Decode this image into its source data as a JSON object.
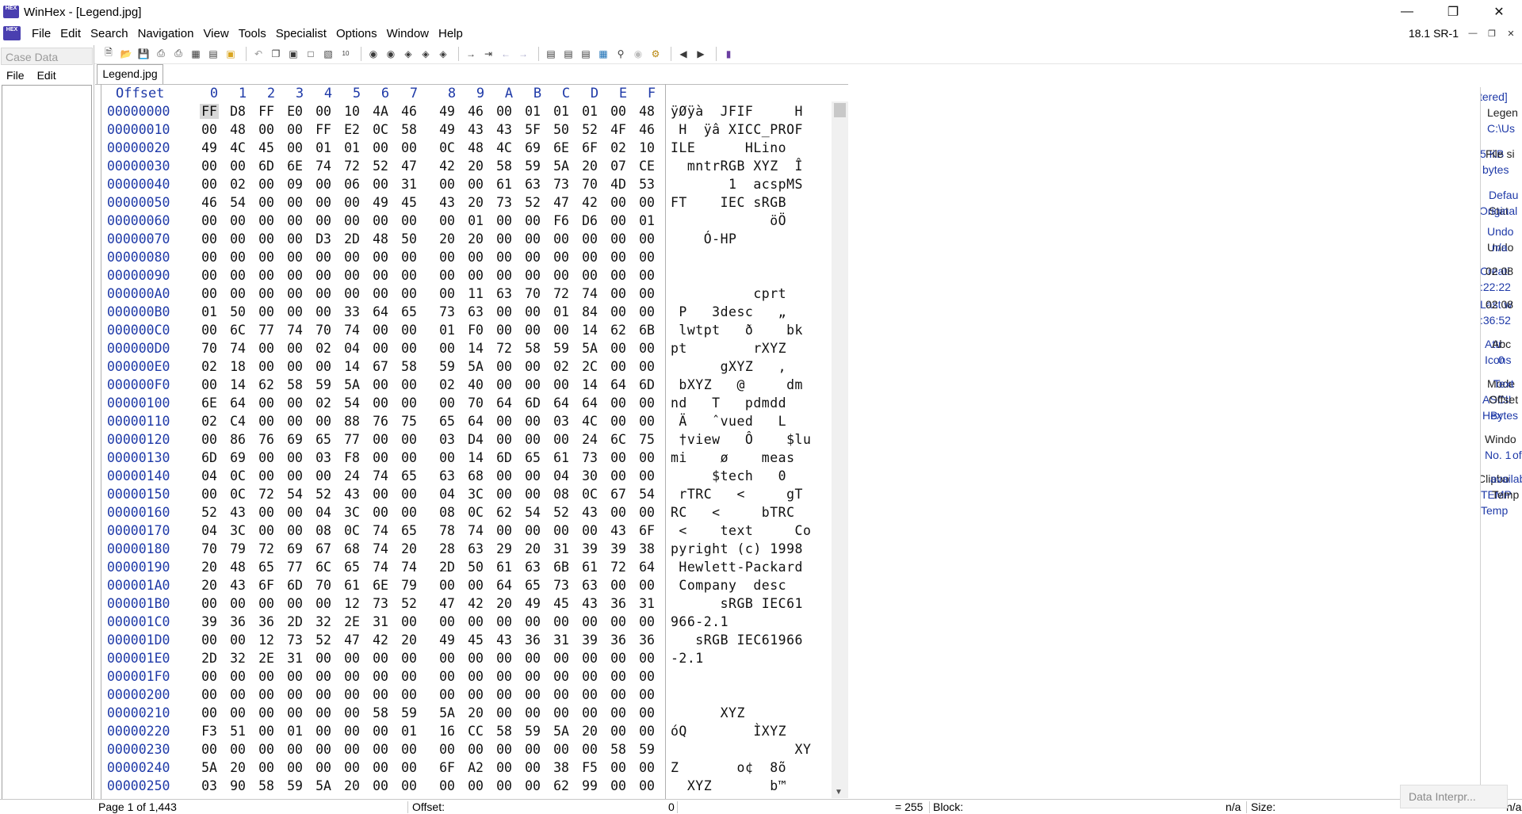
{
  "window": {
    "title": "WinHex - [Legend.jpg]",
    "app_icon": "winhex-app-icon",
    "buttons": [
      "minimize-icon",
      "restore-icon",
      "close-icon"
    ]
  },
  "menubar": {
    "items": [
      "File",
      "Edit",
      "Search",
      "Navigation",
      "View",
      "Tools",
      "Specialist",
      "Options",
      "Window",
      "Help"
    ],
    "version": "18.1 SR-1",
    "mdi_buttons": [
      "minimize-icon",
      "restore-icon",
      "close-icon"
    ]
  },
  "toolbar": {
    "icons": [
      "new-file-icon",
      "open-file-icon",
      "save-icon",
      "save-all-icon",
      "print-icon",
      "properties-icon",
      "open-disk-icon",
      "save-as-icon",
      "undo-icon",
      "copy-icon",
      "cut-icon",
      "paste-icon",
      "paste-clipboard-icon",
      "write-hex-icon",
      "find-text-icon",
      "find-hex-icon",
      "replace-text-icon",
      "replace-hex-icon",
      "find-again-icon",
      "goto-offset-icon",
      "goto-sector-icon",
      "back-icon",
      "forward-icon",
      "open-drive-icon",
      "disk-editor-icon",
      "ram-editor-icon",
      "calculator-icon",
      "search-icon",
      "position-manager-icon",
      "analyze-icon",
      "prev-page-icon",
      "next-page-icon",
      "help-book-icon"
    ]
  },
  "case_panel": {
    "title": "Case Data",
    "menu": [
      "File",
      "Edit"
    ]
  },
  "tab": {
    "label": "Legend.jpg"
  },
  "hex": {
    "offset_header": "Offset",
    "columns": [
      "0",
      "1",
      "2",
      "3",
      "4",
      "5",
      "6",
      "7",
      "8",
      "9",
      "A",
      "B",
      "C",
      "D",
      "E",
      "F"
    ],
    "rows": [
      {
        "offset": "00000000",
        "bytes": [
          "FF",
          "D8",
          "FF",
          "E0",
          "00",
          "10",
          "4A",
          "46",
          "49",
          "46",
          "00",
          "01",
          "01",
          "01",
          "00",
          "48"
        ],
        "ascii": "ÿØÿà  JFIF     H"
      },
      {
        "offset": "00000010",
        "bytes": [
          "00",
          "48",
          "00",
          "00",
          "FF",
          "E2",
          "0C",
          "58",
          "49",
          "43",
          "43",
          "5F",
          "50",
          "52",
          "4F",
          "46"
        ],
        "ascii": " H  ÿâ XICC_PROF"
      },
      {
        "offset": "00000020",
        "bytes": [
          "49",
          "4C",
          "45",
          "00",
          "01",
          "01",
          "00",
          "00",
          "0C",
          "48",
          "4C",
          "69",
          "6E",
          "6F",
          "02",
          "10"
        ],
        "ascii": "ILE      HLino  "
      },
      {
        "offset": "00000030",
        "bytes": [
          "00",
          "00",
          "6D",
          "6E",
          "74",
          "72",
          "52",
          "47",
          "42",
          "20",
          "58",
          "59",
          "5A",
          "20",
          "07",
          "CE"
        ],
        "ascii": "  mntrRGB XYZ  Î"
      },
      {
        "offset": "00000040",
        "bytes": [
          "00",
          "02",
          "00",
          "09",
          "00",
          "06",
          "00",
          "31",
          "00",
          "00",
          "61",
          "63",
          "73",
          "70",
          "4D",
          "53"
        ],
        "ascii": "       1  acspMS"
      },
      {
        "offset": "00000050",
        "bytes": [
          "46",
          "54",
          "00",
          "00",
          "00",
          "00",
          "49",
          "45",
          "43",
          "20",
          "73",
          "52",
          "47",
          "42",
          "00",
          "00"
        ],
        "ascii": "FT    IEC sRGB  "
      },
      {
        "offset": "00000060",
        "bytes": [
          "00",
          "00",
          "00",
          "00",
          "00",
          "00",
          "00",
          "00",
          "00",
          "01",
          "00",
          "00",
          "F6",
          "D6",
          "00",
          "01"
        ],
        "ascii": "            öÖ  "
      },
      {
        "offset": "00000070",
        "bytes": [
          "00",
          "00",
          "00",
          "00",
          "D3",
          "2D",
          "48",
          "50",
          "20",
          "20",
          "00",
          "00",
          "00",
          "00",
          "00",
          "00"
        ],
        "ascii": "    Ó-HP        "
      },
      {
        "offset": "00000080",
        "bytes": [
          "00",
          "00",
          "00",
          "00",
          "00",
          "00",
          "00",
          "00",
          "00",
          "00",
          "00",
          "00",
          "00",
          "00",
          "00",
          "00"
        ],
        "ascii": ""
      },
      {
        "offset": "00000090",
        "bytes": [
          "00",
          "00",
          "00",
          "00",
          "00",
          "00",
          "00",
          "00",
          "00",
          "00",
          "00",
          "00",
          "00",
          "00",
          "00",
          "00"
        ],
        "ascii": ""
      },
      {
        "offset": "000000A0",
        "bytes": [
          "00",
          "00",
          "00",
          "00",
          "00",
          "00",
          "00",
          "00",
          "00",
          "11",
          "63",
          "70",
          "72",
          "74",
          "00",
          "00"
        ],
        "ascii": "          cprt  "
      },
      {
        "offset": "000000B0",
        "bytes": [
          "01",
          "50",
          "00",
          "00",
          "00",
          "33",
          "64",
          "65",
          "73",
          "63",
          "00",
          "00",
          "01",
          "84",
          "00",
          "00"
        ],
        "ascii": " P   3desc   „  "
      },
      {
        "offset": "000000C0",
        "bytes": [
          "00",
          "6C",
          "77",
          "74",
          "70",
          "74",
          "00",
          "00",
          "01",
          "F0",
          "00",
          "00",
          "00",
          "14",
          "62",
          "6B"
        ],
        "ascii": " lwtpt   ð    bk"
      },
      {
        "offset": "000000D0",
        "bytes": [
          "70",
          "74",
          "00",
          "00",
          "02",
          "04",
          "00",
          "00",
          "00",
          "14",
          "72",
          "58",
          "59",
          "5A",
          "00",
          "00"
        ],
        "ascii": "pt        rXYZ  "
      },
      {
        "offset": "000000E0",
        "bytes": [
          "02",
          "18",
          "00",
          "00",
          "00",
          "14",
          "67",
          "58",
          "59",
          "5A",
          "00",
          "00",
          "02",
          "2C",
          "00",
          "00"
        ],
        "ascii": "      gXYZ   ,  "
      },
      {
        "offset": "000000F0",
        "bytes": [
          "00",
          "14",
          "62",
          "58",
          "59",
          "5A",
          "00",
          "00",
          "02",
          "40",
          "00",
          "00",
          "00",
          "14",
          "64",
          "6D"
        ],
        "ascii": " bXYZ   @     dm"
      },
      {
        "offset": "00000100",
        "bytes": [
          "6E",
          "64",
          "00",
          "00",
          "02",
          "54",
          "00",
          "00",
          "00",
          "70",
          "64",
          "6D",
          "64",
          "64",
          "00",
          "00"
        ],
        "ascii": "nd   T   pdmdd  "
      },
      {
        "offset": "00000110",
        "bytes": [
          "02",
          "C4",
          "00",
          "00",
          "00",
          "88",
          "76",
          "75",
          "65",
          "64",
          "00",
          "00",
          "03",
          "4C",
          "00",
          "00"
        ],
        "ascii": " Ä   ˆvued   L  "
      },
      {
        "offset": "00000120",
        "bytes": [
          "00",
          "86",
          "76",
          "69",
          "65",
          "77",
          "00",
          "00",
          "03",
          "D4",
          "00",
          "00",
          "00",
          "24",
          "6C",
          "75"
        ],
        "ascii": " †view   Ô    $lu"
      },
      {
        "offset": "00000130",
        "bytes": [
          "6D",
          "69",
          "00",
          "00",
          "03",
          "F8",
          "00",
          "00",
          "00",
          "14",
          "6D",
          "65",
          "61",
          "73",
          "00",
          "00"
        ],
        "ascii": "mi    ø    meas  "
      },
      {
        "offset": "00000140",
        "bytes": [
          "04",
          "0C",
          "00",
          "00",
          "00",
          "24",
          "74",
          "65",
          "63",
          "68",
          "00",
          "00",
          "04",
          "30",
          "00",
          "00"
        ],
        "ascii": "     $tech   0  "
      },
      {
        "offset": "00000150",
        "bytes": [
          "00",
          "0C",
          "72",
          "54",
          "52",
          "43",
          "00",
          "00",
          "04",
          "3C",
          "00",
          "00",
          "08",
          "0C",
          "67",
          "54"
        ],
        "ascii": " rTRC   <     gT"
      },
      {
        "offset": "00000160",
        "bytes": [
          "52",
          "43",
          "00",
          "00",
          "04",
          "3C",
          "00",
          "00",
          "08",
          "0C",
          "62",
          "54",
          "52",
          "43",
          "00",
          "00"
        ],
        "ascii": "RC   <     bTRC  "
      },
      {
        "offset": "00000170",
        "bytes": [
          "04",
          "3C",
          "00",
          "00",
          "08",
          "0C",
          "74",
          "65",
          "78",
          "74",
          "00",
          "00",
          "00",
          "00",
          "43",
          "6F"
        ],
        "ascii": " <    text     Co"
      },
      {
        "offset": "00000180",
        "bytes": [
          "70",
          "79",
          "72",
          "69",
          "67",
          "68",
          "74",
          "20",
          "28",
          "63",
          "29",
          "20",
          "31",
          "39",
          "39",
          "38"
        ],
        "ascii": "pyright (c) 1998"
      },
      {
        "offset": "00000190",
        "bytes": [
          "20",
          "48",
          "65",
          "77",
          "6C",
          "65",
          "74",
          "74",
          "2D",
          "50",
          "61",
          "63",
          "6B",
          "61",
          "72",
          "64"
        ],
        "ascii": " Hewlett-Packard"
      },
      {
        "offset": "000001A0",
        "bytes": [
          "20",
          "43",
          "6F",
          "6D",
          "70",
          "61",
          "6E",
          "79",
          "00",
          "00",
          "64",
          "65",
          "73",
          "63",
          "00",
          "00"
        ],
        "ascii": " Company  desc  "
      },
      {
        "offset": "000001B0",
        "bytes": [
          "00",
          "00",
          "00",
          "00",
          "00",
          "12",
          "73",
          "52",
          "47",
          "42",
          "20",
          "49",
          "45",
          "43",
          "36",
          "31"
        ],
        "ascii": "      sRGB IEC61"
      },
      {
        "offset": "000001C0",
        "bytes": [
          "39",
          "36",
          "36",
          "2D",
          "32",
          "2E",
          "31",
          "00",
          "00",
          "00",
          "00",
          "00",
          "00",
          "00",
          "00",
          "00"
        ],
        "ascii": "966-2.1         "
      },
      {
        "offset": "000001D0",
        "bytes": [
          "00",
          "00",
          "12",
          "73",
          "52",
          "47",
          "42",
          "20",
          "49",
          "45",
          "43",
          "36",
          "31",
          "39",
          "36",
          "36"
        ],
        "ascii": "   sRGB IEC61966"
      },
      {
        "offset": "000001E0",
        "bytes": [
          "2D",
          "32",
          "2E",
          "31",
          "00",
          "00",
          "00",
          "00",
          "00",
          "00",
          "00",
          "00",
          "00",
          "00",
          "00",
          "00"
        ],
        "ascii": "-2.1            "
      },
      {
        "offset": "000001F0",
        "bytes": [
          "00",
          "00",
          "00",
          "00",
          "00",
          "00",
          "00",
          "00",
          "00",
          "00",
          "00",
          "00",
          "00",
          "00",
          "00",
          "00"
        ],
        "ascii": ""
      },
      {
        "offset": "00000200",
        "bytes": [
          "00",
          "00",
          "00",
          "00",
          "00",
          "00",
          "00",
          "00",
          "00",
          "00",
          "00",
          "00",
          "00",
          "00",
          "00",
          "00"
        ],
        "ascii": ""
      },
      {
        "offset": "00000210",
        "bytes": [
          "00",
          "00",
          "00",
          "00",
          "00",
          "00",
          "58",
          "59",
          "5A",
          "20",
          "00",
          "00",
          "00",
          "00",
          "00",
          "00"
        ],
        "ascii": "      XYZ       "
      },
      {
        "offset": "00000220",
        "bytes": [
          "F3",
          "51",
          "00",
          "01",
          "00",
          "00",
          "00",
          "01",
          "16",
          "CC",
          "58",
          "59",
          "5A",
          "20",
          "00",
          "00"
        ],
        "ascii": "óQ        ÌXYZ  "
      },
      {
        "offset": "00000230",
        "bytes": [
          "00",
          "00",
          "00",
          "00",
          "00",
          "00",
          "00",
          "00",
          "00",
          "00",
          "00",
          "00",
          "00",
          "00",
          "58",
          "59"
        ],
        "ascii": "               XY"
      },
      {
        "offset": "00000240",
        "bytes": [
          "5A",
          "20",
          "00",
          "00",
          "00",
          "00",
          "00",
          "00",
          "6F",
          "A2",
          "00",
          "00",
          "38",
          "F5",
          "00",
          "00"
        ],
        "ascii": "Z       o¢  8õ  "
      },
      {
        "offset": "00000250",
        "bytes": [
          "03",
          "90",
          "58",
          "59",
          "5A",
          "20",
          "00",
          "00",
          "00",
          "00",
          "00",
          "00",
          "62",
          "99",
          "00",
          "00"
        ],
        "ascii": "  XYZ       b™  "
      }
    ]
  },
  "info_panel": {
    "lines": [
      "tered]",
      "Legen",
      "C:\\Us",
      "5 KB",
      "File si",
      "bytes",
      "Defau",
      "Stat",
      "Original",
      "Undo",
      "Undo",
      "n/a",
      "Creati",
      "02 08",
      ":22:22",
      "Last w",
      "02 08",
      ":36:52",
      "Attr",
      "Abc",
      "Icons",
      "0",
      "Mode",
      "Text",
      "ASCII",
      "Offset",
      "Hex",
      "Bytes",
      "Windo",
      "No. 1",
      "of",
      "Clipbo",
      "available",
      "TEMP",
      "Temp",
      "Temp"
    ]
  },
  "statusbar": {
    "page": "Page 1 of 1,443",
    "offset_label": "Offset:",
    "offset_value": "0",
    "value": "= 255",
    "block_label": "Block:",
    "block_value": "n/a",
    "size_label": "Size:",
    "size_value": "n/a"
  },
  "data_interpreter": {
    "label": "Data Interpr..."
  }
}
